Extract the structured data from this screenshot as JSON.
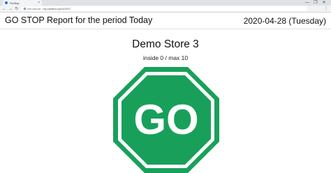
{
  "browser": {
    "tab_title": "GoStop",
    "tab_close": "×",
    "security_label": "Not secure",
    "url": "my.camera.xyz/123/17",
    "window_controls": [
      "—",
      "❐",
      "✕"
    ],
    "nav_icons": [
      "←",
      "→",
      "↻"
    ],
    "menu_icon": "⋮"
  },
  "header": {
    "title": "GO STOP Report for the period Today",
    "date": "2020-04-28 (Tuesday)"
  },
  "store": {
    "name": "Demo Store 3",
    "occupancy": "inside 0 / max 10"
  },
  "sign": {
    "label": "GO",
    "fill_color": "#18a05a",
    "border_color": "#ffffff",
    "outer_color": "#18a05a",
    "shape": "octagon"
  }
}
